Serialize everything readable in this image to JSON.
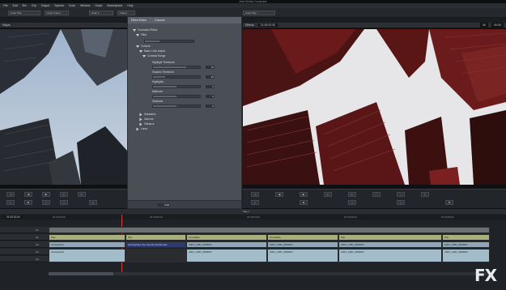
{
  "window": {
    "title": "Avid Media Composer"
  },
  "menu": [
    "File",
    "Edit",
    "Bin",
    "Clip",
    "Output",
    "Special",
    "Tools",
    "Window",
    "Script",
    "Marketplace",
    "Help"
  ],
  "toolbar": {
    "items": [
      "Color Title",
      "Color Frame",
      "Color 1",
      "Frame",
      "Color Title"
    ]
  },
  "source_monitor": {
    "name": "Rayes",
    "timecode": "01:00:02:00"
  },
  "record_monitor": {
    "name": "Effects",
    "timecode": "01:00:02:00",
    "right_tc1": "00",
    "right_tc2": "00:00"
  },
  "effect_editor": {
    "title": "Effect Editor",
    "tab2": "Colorize",
    "rows": [
      {
        "label": "Correction Filters",
        "value": ""
      },
      {
        "label": "Filter",
        "value": ""
      },
      {
        "label": "Colorize",
        "value": ""
      },
      {
        "label": "Basic Color Adjust",
        "value": ""
      },
      {
        "label": "Contrast Range",
        "value": ""
      },
      {
        "label": "Highlight Threshold",
        "value": "70"
      },
      {
        "label": "Shadow Threshold",
        "value": "25"
      },
      {
        "label": "Highlights",
        "value": "0"
      },
      {
        "label": "Midtones",
        "value": "0"
      },
      {
        "label": "Shadows",
        "value": "0"
      },
      {
        "label": "Saturation",
        "value": ""
      },
      {
        "label": "Gamma",
        "value": ""
      },
      {
        "label": "Vibrance",
        "value": ""
      },
      {
        "label": "Luma",
        "value": ""
      }
    ],
    "footer_value": "0:00"
  },
  "timeline": {
    "sequence_name": "Seq 1",
    "timecode": "01:00:02:00",
    "ruler": [
      "01:00:00:00",
      "01:00:02:00",
      "01:00:04:00",
      "01:00:06:00",
      "01:00:08:00"
    ],
    "tracks": [
      "V1",
      "A1",
      "A2",
      "A3",
      "A4"
    ],
    "video_clips": [
      "Pan",
      "Pan",
      "Crossfade",
      "Crossfade",
      "Pan",
      "Pan"
    ],
    "audio1_clips": [
      "Atmosphere",
      "Atmosphere city sounds sounds.wav",
      "A001_C001_0826RN",
      "A001_C001_0826RN",
      "A001_C001_0826RN",
      "A001_C001_0826RN"
    ],
    "audio2_clips": [
      "Atmosphere",
      "",
      "A001_C001_0826RN",
      "A001_C001_0826RN",
      "A001_C001_0826RN",
      "A001_C001_0826RN"
    ]
  },
  "watermark": "FX"
}
